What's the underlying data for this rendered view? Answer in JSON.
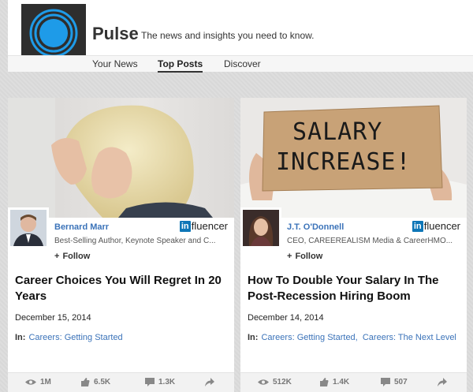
{
  "header": {
    "brand": "Pulse",
    "tagline": "The news and insights you need to know.",
    "nav": [
      {
        "label": "Your News",
        "active": false
      },
      {
        "label": "Top Posts",
        "active": true
      },
      {
        "label": "Discover",
        "active": false
      }
    ]
  },
  "cards": [
    {
      "author": {
        "name": "Bernard Marr",
        "description": "Best-Selling Author, Keynote Speaker and C...",
        "badge": "fluencer",
        "badge_in": "in"
      },
      "follow": "Follow",
      "title": "Career Choices You Will Regret In 20 Years",
      "date": "December 15, 2014",
      "tags_label": "In:",
      "tags": [
        "Careers: Getting Started"
      ],
      "stats": {
        "views": "1M",
        "likes": "6.5K",
        "comments": "1.3K"
      }
    },
    {
      "image_sign": {
        "line1": "SALARY",
        "line2": "INCREASE!"
      },
      "author": {
        "name": "J.T. O'Donnell",
        "description": "CEO, CAREEREALISM Media & CareerHMO...",
        "badge": "fluencer",
        "badge_in": "in"
      },
      "follow": "Follow",
      "title": "How To Double Your Salary In The Post-Recession Hiring Boom",
      "date": "December 14, 2014",
      "tags_label": "In:",
      "tags": [
        "Careers: Getting Started,",
        "Careers: The Next Level"
      ],
      "stats": {
        "views": "512K",
        "likes": "1.4K",
        "comments": "507"
      }
    }
  ],
  "colors": {
    "link": "#3b73b9",
    "logo_blue": "#1e9be8",
    "linkedin": "#0e76b7"
  }
}
